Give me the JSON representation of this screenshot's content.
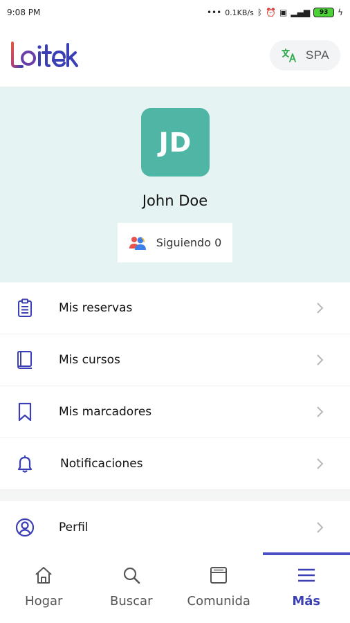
{
  "status_bar": {
    "time": "9:08 PM",
    "net_speed": "0.1KB/s",
    "battery": "93"
  },
  "header": {
    "logo_text": "Loitek",
    "language_label": "SPA"
  },
  "profile": {
    "initials": "JD",
    "name": "John Doe",
    "following_label": "Siguiendo 0"
  },
  "menu": {
    "items": [
      {
        "label": "Mis reservas",
        "icon": "clipboard-icon"
      },
      {
        "label": "Mis cursos",
        "icon": "book-icon"
      },
      {
        "label": "Mis marcadores",
        "icon": "bookmark-icon"
      },
      {
        "label": "Notificaciones",
        "icon": "bell-icon"
      },
      {
        "label": "Perfil",
        "icon": "user-circle-icon"
      }
    ]
  },
  "bottom_nav": {
    "tabs": [
      {
        "label": "Hogar",
        "icon": "home-icon"
      },
      {
        "label": "Buscar",
        "icon": "search-icon"
      },
      {
        "label": "Comunida",
        "icon": "calendar-window-icon"
      },
      {
        "label": "Más",
        "icon": "menu-icon",
        "active": true
      }
    ]
  },
  "colors": {
    "accent": "#4a4fc4",
    "avatar_bg": "#4fb6a6",
    "banner_bg": "#e6f3f3"
  }
}
